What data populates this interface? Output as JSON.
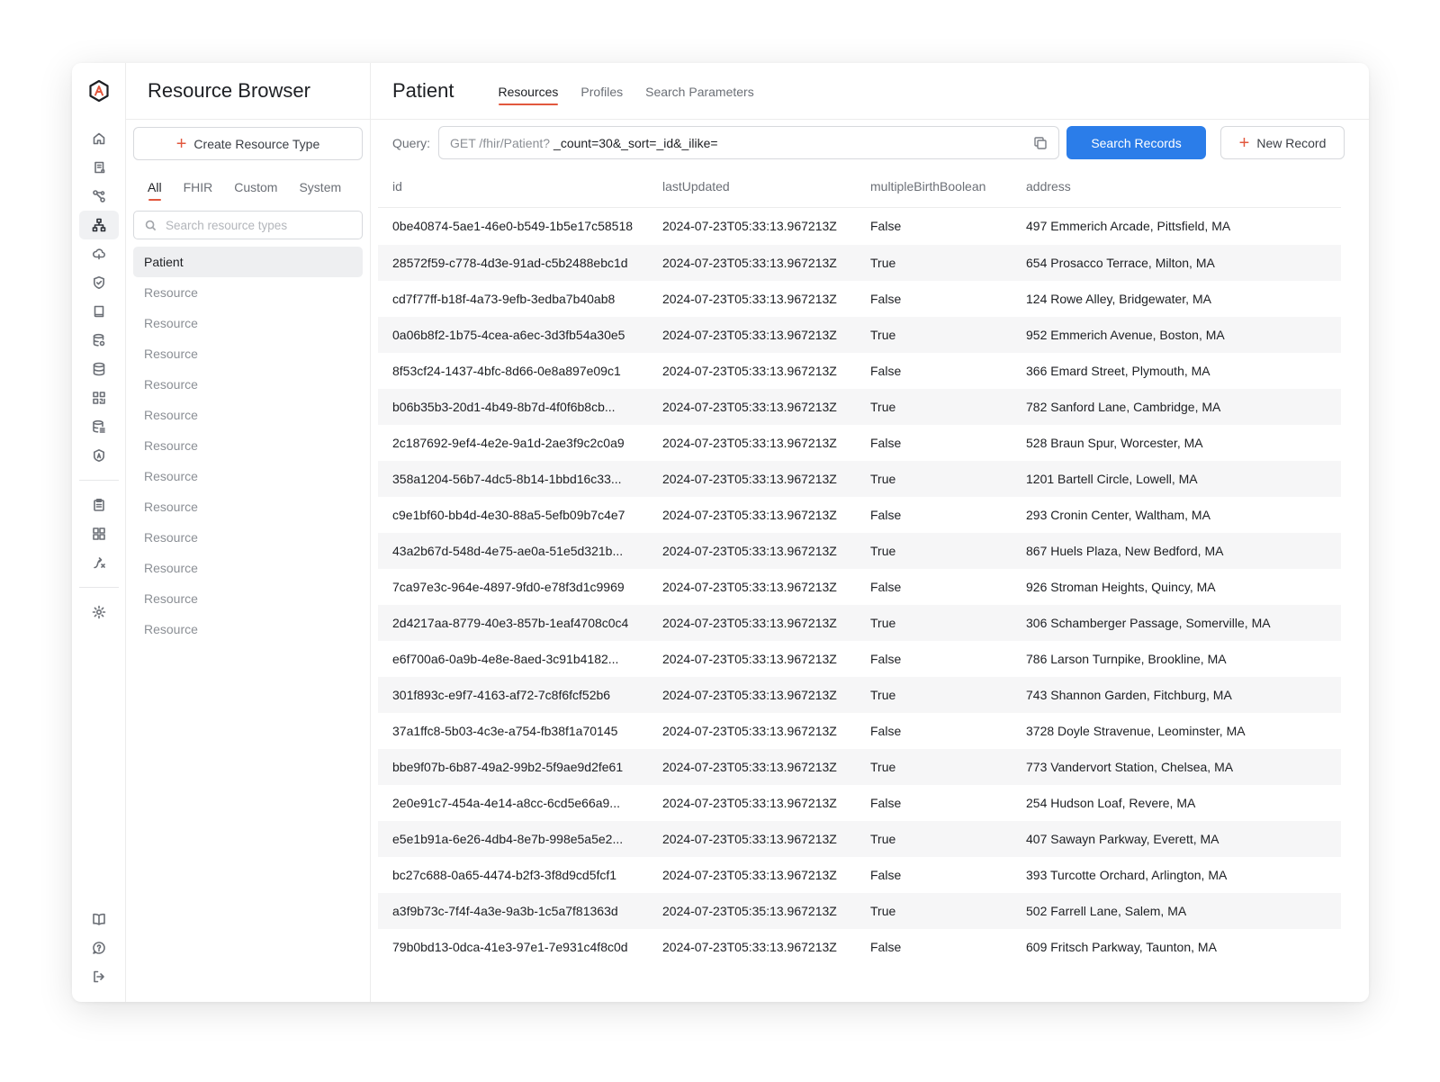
{
  "colors": {
    "accent": "#e2583e",
    "primary": "#2b7de9"
  },
  "rail": {
    "top_icons": [
      "home-icon",
      "scroll-icon",
      "nodes-icon",
      "hierarchy-icon",
      "cloud-icon",
      "shield-check-icon",
      "book-closed-icon",
      "database-search-icon",
      "database-icon",
      "qr-code-icon",
      "database-list-icon",
      "shield-badge-icon"
    ],
    "middle_icons": [
      "clipboard-icon",
      "grid-icon",
      "route-icon"
    ],
    "settings_icon": "gear-icon",
    "bottom_icons": [
      "book-open-icon",
      "help-chat-icon",
      "logout-icon"
    ]
  },
  "panel": {
    "title": "Resource Browser",
    "create_label": "Create Resource Type",
    "tabs": [
      "All",
      "FHIR",
      "Custom",
      "System"
    ],
    "active_tab": "All",
    "search_placeholder": "Search resource types",
    "types": [
      "Patient",
      "Resource",
      "Resource",
      "Resource",
      "Resource",
      "Resource",
      "Resource",
      "Resource",
      "Resource",
      "Resource",
      "Resource",
      "Resource",
      "Resource"
    ]
  },
  "main": {
    "title": "Patient",
    "tabs": [
      "Resources",
      "Profiles",
      "Search Parameters"
    ],
    "active_tab": "Resources",
    "query_label": "Query:",
    "query_prefix": "GET /fhir/Patient?",
    "query_params": "_count=30&_sort=_id&_ilike=",
    "search_button": "Search Records",
    "new_record_button": "New Record"
  },
  "table": {
    "columns": [
      "id",
      "lastUpdated",
      "multipleBirthBoolean",
      "address"
    ],
    "rows": [
      [
        "0be40874-5ae1-46e0-b549-1b5e17c58518",
        "2024-07-23T05:33:13.967213Z",
        "False",
        "497 Emmerich Arcade, Pittsfield, MA"
      ],
      [
        "28572f59-c778-4d3e-91ad-c5b2488ebc1d",
        "2024-07-23T05:33:13.967213Z",
        "True",
        "654 Prosacco Terrace, Milton, MA"
      ],
      [
        "cd7f77ff-b18f-4a73-9efb-3edba7b40ab8",
        "2024-07-23T05:33:13.967213Z",
        "False",
        "124 Rowe Alley, Bridgewater, MA"
      ],
      [
        "0a06b8f2-1b75-4cea-a6ec-3d3fb54a30e5",
        "2024-07-23T05:33:13.967213Z",
        "True",
        "952 Emmerich Avenue, Boston, MA"
      ],
      [
        "8f53cf24-1437-4bfc-8d66-0e8a897e09c1",
        "2024-07-23T05:33:13.967213Z",
        "False",
        "366 Emard Street, Plymouth, MA"
      ],
      [
        "b06b35b3-20d1-4b49-8b7d-4f0f6b8cb...",
        "2024-07-23T05:33:13.967213Z",
        "True",
        "782 Sanford Lane, Cambridge, MA"
      ],
      [
        "2c187692-9ef4-4e2e-9a1d-2ae3f9c2c0a9",
        "2024-07-23T05:33:13.967213Z",
        "False",
        "528 Braun Spur, Worcester, MA"
      ],
      [
        "358a1204-56b7-4dc5-8b14-1bbd16c33...",
        "2024-07-23T05:33:13.967213Z",
        "True",
        "1201 Bartell Circle, Lowell, MA"
      ],
      [
        "c9e1bf60-bb4d-4e30-88a5-5efb09b7c4e7",
        "2024-07-23T05:33:13.967213Z",
        "False",
        "293 Cronin Center, Waltham, MA"
      ],
      [
        "43a2b67d-548d-4e75-ae0a-51e5d321b...",
        "2024-07-23T05:33:13.967213Z",
        "True",
        "867 Huels Plaza, New Bedford, MA"
      ],
      [
        "7ca97e3c-964e-4897-9fd0-e78f3d1c9969",
        "2024-07-23T05:33:13.967213Z",
        "False",
        "926 Stroman Heights, Quincy, MA"
      ],
      [
        "2d4217aa-8779-40e3-857b-1eaf4708c0c4",
        "2024-07-23T05:33:13.967213Z",
        "True",
        "306 Schamberger Passage, Somerville, MA"
      ],
      [
        "e6f700a6-0a9b-4e8e-8aed-3c91b4182...",
        "2024-07-23T05:33:13.967213Z",
        "False",
        "786 Larson Turnpike, Brookline, MA"
      ],
      [
        "301f893c-e9f7-4163-af72-7c8f6fcf52b6",
        "2024-07-23T05:33:13.967213Z",
        "True",
        "743 Shannon Garden, Fitchburg, MA"
      ],
      [
        "37a1ffc8-5b03-4c3e-a754-fb38f1a70145",
        "2024-07-23T05:33:13.967213Z",
        "False",
        "3728 Doyle Stravenue, Leominster, MA"
      ],
      [
        "bbe9f07b-6b87-49a2-99b2-5f9ae9d2fe61",
        "2024-07-23T05:33:13.967213Z",
        "True",
        "773 Vandervort Station, Chelsea, MA"
      ],
      [
        "2e0e91c7-454a-4e14-a8cc-6cd5e66a9...",
        "2024-07-23T05:33:13.967213Z",
        "False",
        "254 Hudson Loaf, Revere, MA"
      ],
      [
        "e5e1b91a-6e26-4db4-8e7b-998e5a5e2...",
        "2024-07-23T05:33:13.967213Z",
        "True",
        "407 Sawayn Parkway, Everett, MA"
      ],
      [
        "bc27c688-0a65-4474-b2f3-3f8d9cd5fcf1",
        "2024-07-23T05:33:13.967213Z",
        "False",
        "393 Turcotte Orchard, Arlington, MA"
      ],
      [
        "a3f9b73c-7f4f-4a3e-9a3b-1c5a7f81363d",
        "2024-07-23T05:35:13.967213Z",
        "True",
        "502 Farrell Lane, Salem, MA"
      ],
      [
        "79b0bd13-0dca-41e3-97e1-7e931c4f8c0d",
        "2024-07-23T05:33:13.967213Z",
        "False",
        "609 Fritsch Parkway, Taunton, MA"
      ]
    ]
  }
}
